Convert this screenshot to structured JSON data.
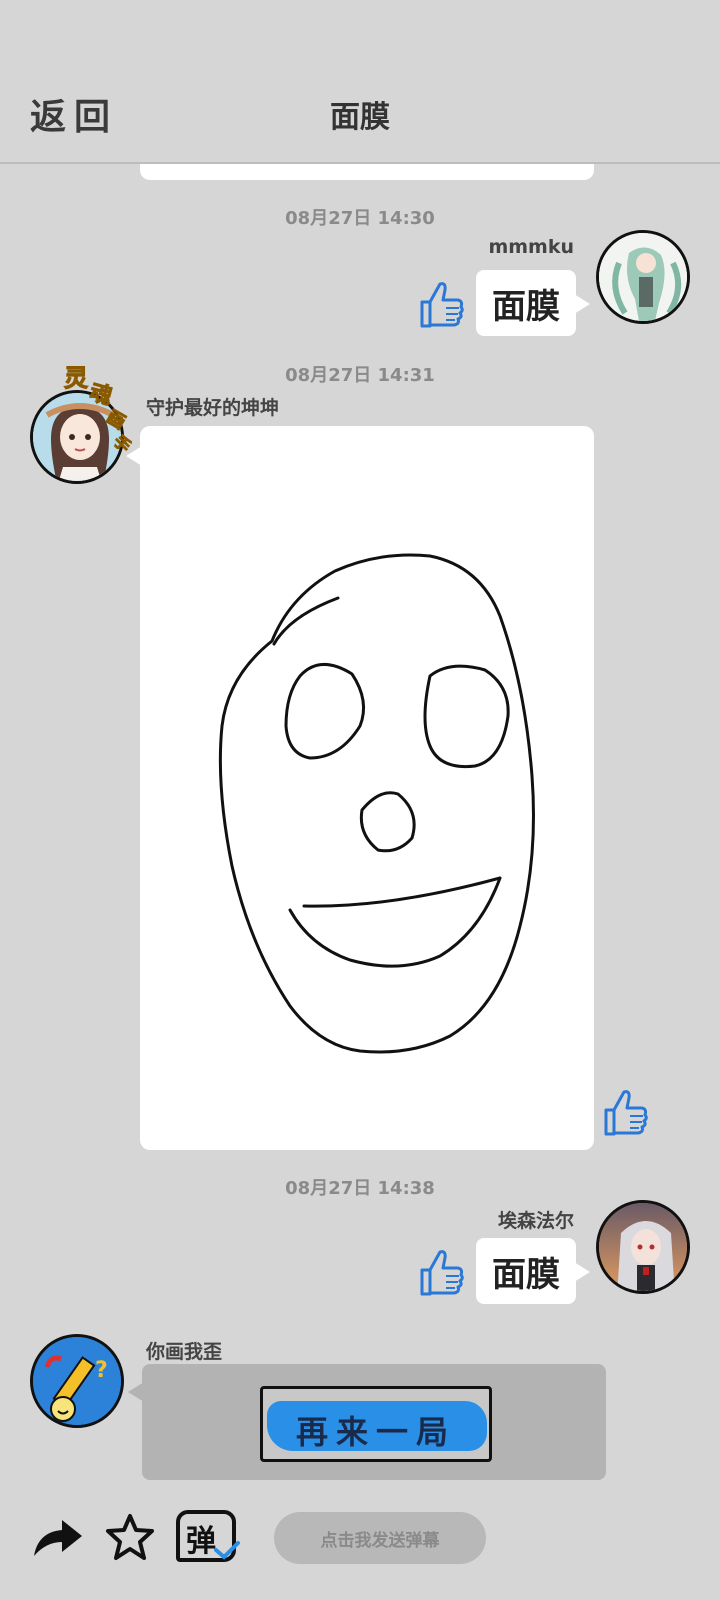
{
  "header": {
    "back_label": "返回",
    "title": "面膜"
  },
  "messages": [
    {
      "timestamp": "08月27日  14:30",
      "user": "mmmku",
      "text": "面膜"
    },
    {
      "timestamp": "08月27日  14:31",
      "user": "守护最好的坤坤",
      "badge_text": "灵魂画手"
    },
    {
      "timestamp": "08月27日  14:38",
      "user": "埃森法尔",
      "text": "面膜"
    },
    {
      "user": "你画我歪",
      "button_label": "再来一局"
    }
  ],
  "bottom_bar": {
    "share_icon": "share-arrow-icon",
    "favorite_icon": "star-icon",
    "danmu_icon_text": "弹",
    "danmu_placeholder": "点击我发送弹幕"
  },
  "colors": {
    "background": "#d6d6d6",
    "accent_blue": "#2a8fe6",
    "bubble": "#ffffff"
  }
}
